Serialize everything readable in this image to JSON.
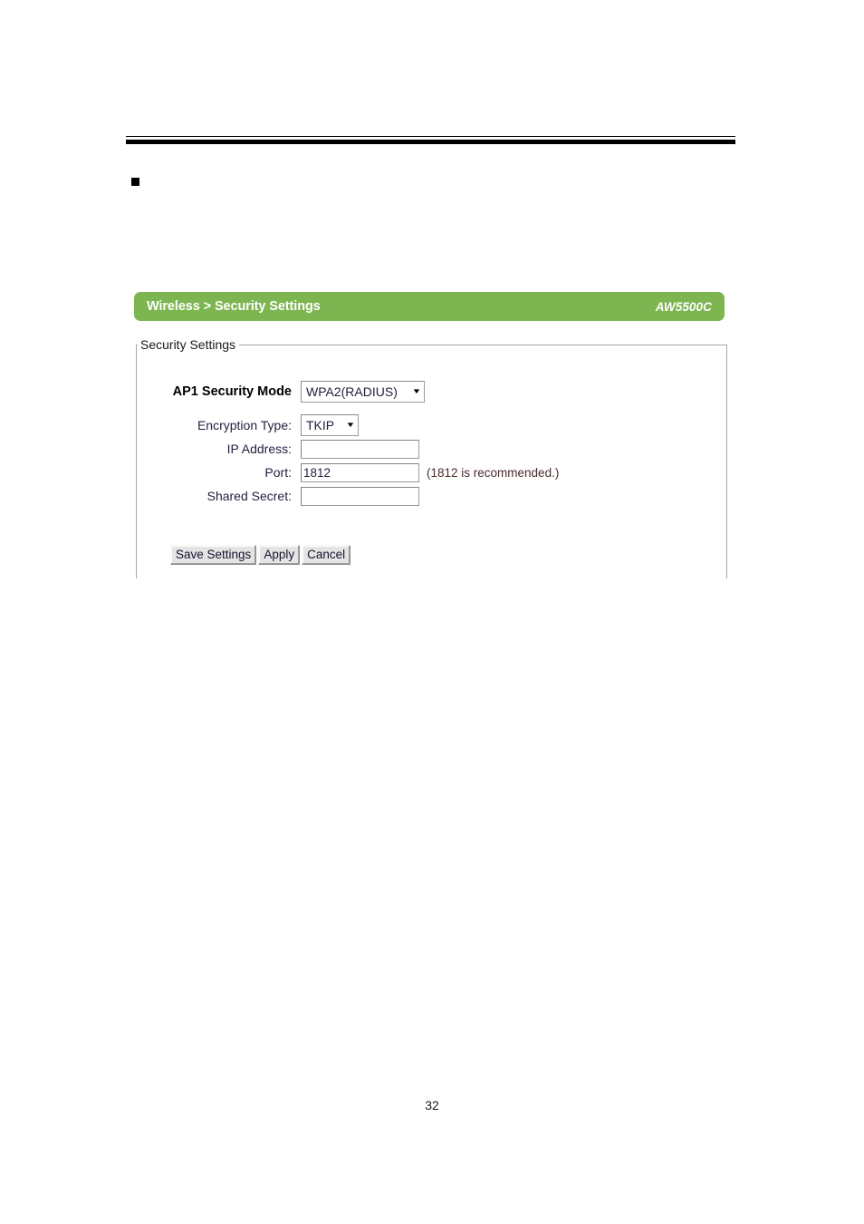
{
  "document": {
    "page_number": "32",
    "bullet_marker": "square-bullet"
  },
  "router_ui": {
    "header": {
      "breadcrumb": "Wireless > Security Settings",
      "model": "AW5500C",
      "background_color": "#7db550",
      "text_color": "#ffffff"
    },
    "panel": {
      "legend": "Security Settings"
    },
    "fields": {
      "security_mode": {
        "label": "AP1 Security Mode",
        "value": "WPA2(RADIUS)",
        "caret": "▼"
      },
      "encryption_type": {
        "label": "Encryption Type:",
        "value": "TKIP",
        "caret": "▼"
      },
      "ip_address": {
        "label": "IP Address:",
        "value": "",
        "placeholder": ""
      },
      "port": {
        "label": "Port:",
        "value": "1812",
        "hint": "(1812 is recommended.)"
      },
      "shared_secret": {
        "label": "Shared Secret:",
        "value": "",
        "placeholder": ""
      }
    },
    "buttons": {
      "save": "Save Settings",
      "apply": "Apply",
      "cancel": "Cancel"
    }
  }
}
